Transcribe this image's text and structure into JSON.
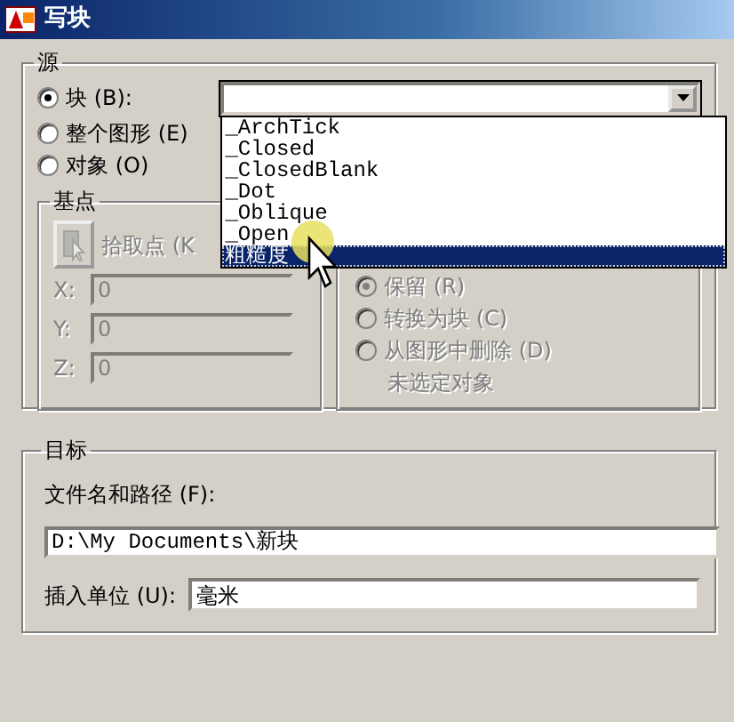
{
  "window": {
    "title": "写块"
  },
  "source": {
    "label": "源",
    "options": [
      {
        "label": "块 (B):",
        "selected": true
      },
      {
        "label": "整个图形 (E)",
        "selected": false
      },
      {
        "label": "对象 (O)",
        "selected": false
      }
    ],
    "block_combo": {
      "expanded": true
    },
    "dropdown_items": [
      {
        "label": "_ArchTick",
        "selected": false
      },
      {
        "label": "_Closed",
        "selected": false
      },
      {
        "label": "_ClosedBlank",
        "selected": false
      },
      {
        "label": "_Dot",
        "selected": false
      },
      {
        "label": "_Oblique",
        "selected": false
      },
      {
        "label": "_Open",
        "selected": false
      },
      {
        "label": "粗糙度",
        "selected": true
      }
    ],
    "base_point": {
      "label": "基点",
      "disabled": true,
      "pick_label": "拾取点 (K",
      "fields": [
        {
          "label": "X:",
          "value": "0"
        },
        {
          "label": "Y:",
          "value": "0"
        },
        {
          "label": "Z:",
          "value": "0"
        }
      ]
    },
    "objects": {
      "disabled": true,
      "options": [
        {
          "label": "保留 (R)",
          "selected": true
        },
        {
          "label": "转换为块 (C)",
          "selected": false
        },
        {
          "label": "从图形中删除 (D)",
          "selected": false
        }
      ],
      "status": "未选定对象"
    }
  },
  "target": {
    "label": "目标",
    "file_label": "文件名和路径 (F):",
    "file_path": "D:\\My Documents\\新块",
    "units_label": "插入单位 (U):",
    "units": "毫米"
  }
}
